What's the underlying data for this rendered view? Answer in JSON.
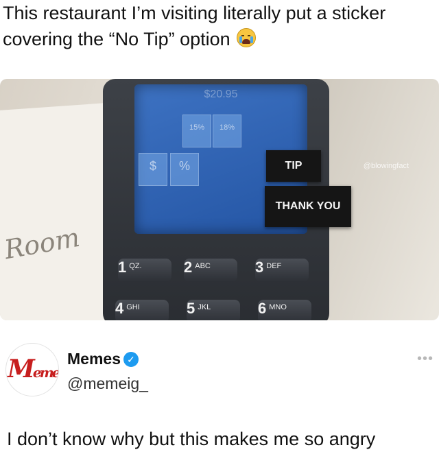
{
  "caption": {
    "line1": "This restaurant I’m visiting literally put a sticker",
    "line2": "covering the “No Tip” option",
    "emoji": "loudly-crying-face-icon"
  },
  "photo": {
    "screen_amount": "$20.95",
    "tip_options": [
      "15%",
      "18%"
    ],
    "sticker_tip": "TIP",
    "sticker_thanks": "THANK YOU",
    "currency_symbol": "$",
    "percent_symbol": "%",
    "watermark": "@blowingfact",
    "scribble": "Room",
    "keys": [
      {
        "num": "1",
        "letters": "QZ."
      },
      {
        "num": "2",
        "letters": "ABC"
      },
      {
        "num": "3",
        "letters": "DEF"
      },
      {
        "num": "4",
        "letters": "GHI"
      },
      {
        "num": "5",
        "letters": "JKL"
      },
      {
        "num": "6",
        "letters": "MNO"
      }
    ]
  },
  "author": {
    "name": "Memes",
    "handle": "@memeig_",
    "verified": true,
    "more_icon": "more-dots-icon"
  },
  "tweet": {
    "text": "I don’t know why but this makes me so angry"
  },
  "colors": {
    "verified": "#1d9bf0",
    "logo_red": "#c71e1e",
    "screen_blue": "#2f63b3"
  }
}
